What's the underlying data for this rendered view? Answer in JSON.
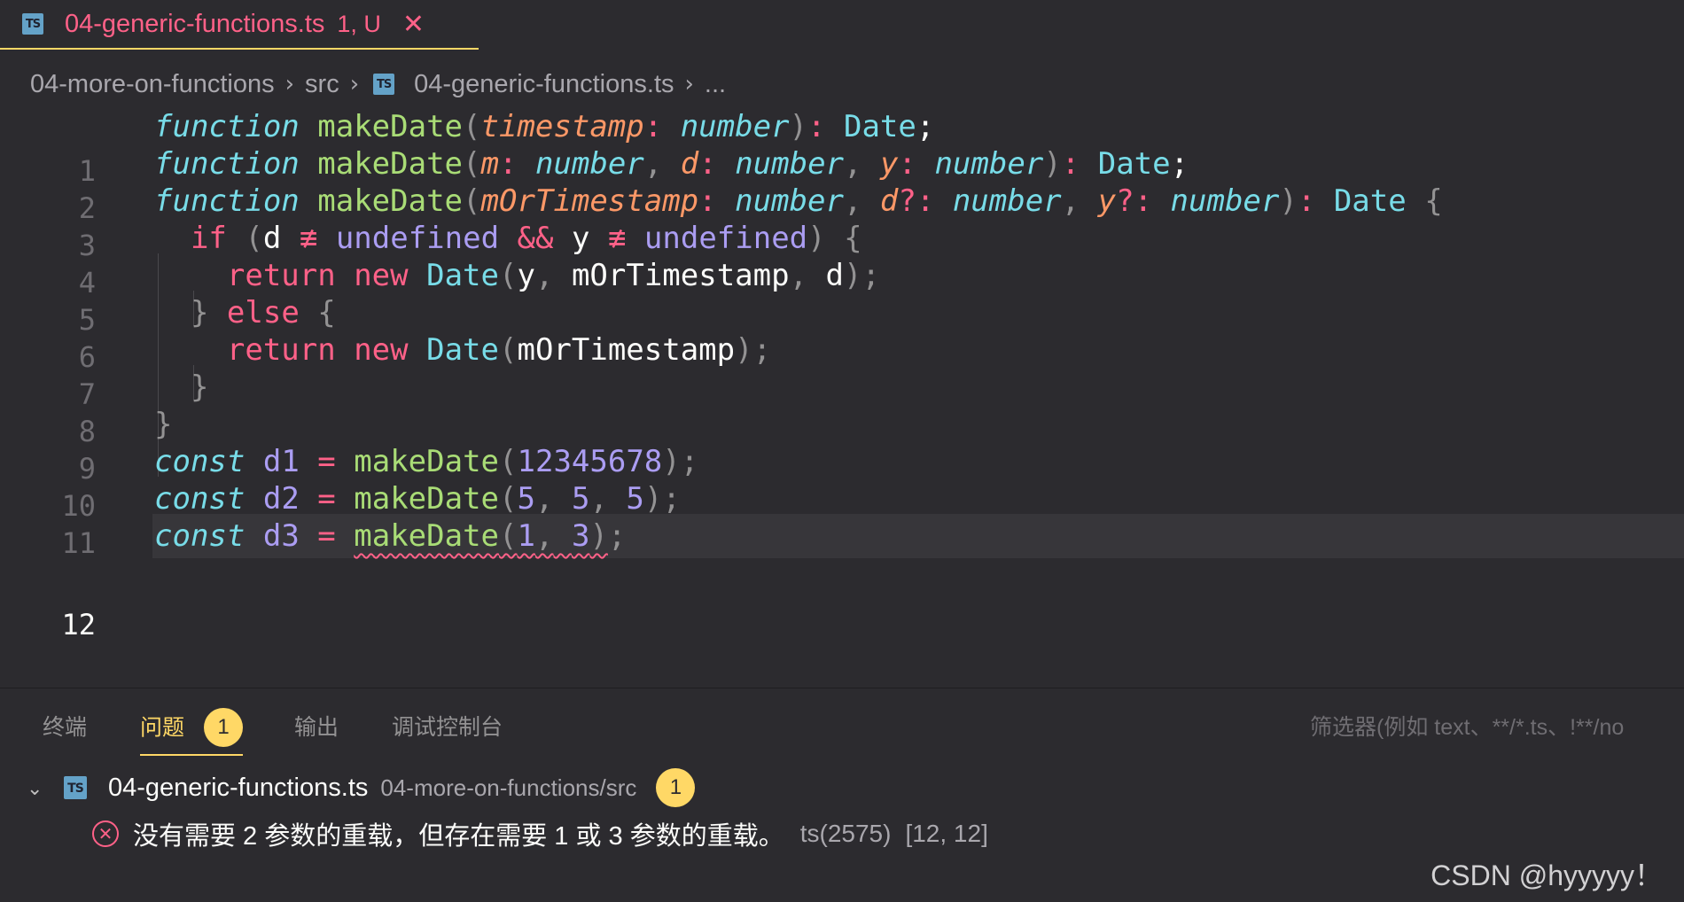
{
  "tab": {
    "icon": "TS",
    "filename": "04-generic-functions.ts",
    "status": "1, U",
    "close": "✕"
  },
  "breadcrumb": {
    "folder": "04-more-on-functions",
    "src": "src",
    "file": "04-generic-functions.ts",
    "more": "..."
  },
  "editor": {
    "line_numbers": [
      "1",
      "2",
      "3",
      "4",
      "5",
      "6",
      "7",
      "8",
      "9",
      "10",
      "11",
      "12"
    ],
    "current_line": "12",
    "lines": [
      "function makeDate(timestamp: number): Date;",
      "function makeDate(m: number, d: number, y: number): Date;",
      "function makeDate(mOrTimestamp: number, d?: number, y?: number): Date {",
      "  if (d !== undefined && y !== undefined) {",
      "    return new Date(y, mOrTimestamp, d);",
      "  } else {",
      "    return new Date(mOrTimestamp);",
      "  }",
      "}",
      "const d1 = makeDate(12345678);",
      "const d2 = makeDate(5, 5, 5);",
      "const d3 = makeDate(1, 3);"
    ]
  },
  "panel": {
    "tabs": {
      "terminal": "终端",
      "problems": "问题",
      "problems_count": "1",
      "output": "输出",
      "debug_console": "调试控制台"
    },
    "filter_placeholder": "筛选器(例如 text、**/*.ts、!**/no",
    "problem_file": {
      "name": "04-generic-functions.ts",
      "path": "04-more-on-functions/src",
      "count": "1"
    },
    "problem": {
      "message": "没有需要 2 参数的重载，但存在需要 1 或 3 参数的重载。",
      "code": "ts(2575)",
      "position": "[12, 12]"
    }
  },
  "watermark": "CSDN @hyyyyy！",
  "colors": {
    "background": "#2c2b2f",
    "accent": "#ffd866",
    "error": "#ff6188",
    "keyword": "#ff6188",
    "function": "#a9dc76",
    "type": "#78dce8",
    "parameter": "#fc9867",
    "number": "#ab9df2"
  }
}
